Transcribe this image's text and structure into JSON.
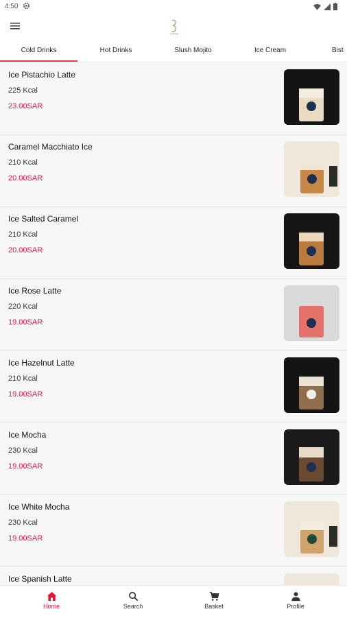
{
  "status": {
    "time": "4:50"
  },
  "tabs": [
    {
      "label": "Cold Drinks",
      "active": true
    },
    {
      "label": "Hot Drinks",
      "active": false
    },
    {
      "label": "Slush Mojito",
      "active": false
    },
    {
      "label": "Ice Cream",
      "active": false
    },
    {
      "label": "Bist",
      "active": false
    }
  ],
  "items": [
    {
      "name": "Ice Pistachio Latte",
      "kcal": "225 Kcal",
      "price": "23.00SAR",
      "image": "dark-bg"
    },
    {
      "name": "Caramel Macchiato Ice",
      "kcal": "210 Kcal",
      "price": "20.00SAR",
      "image": "light-bg"
    },
    {
      "name": "Ice Salted Caramel",
      "kcal": "210 Kcal",
      "price": "20.00SAR",
      "image": "dark-bg"
    },
    {
      "name": "Ice Rose Latte",
      "kcal": "220 Kcal",
      "price": "19.00SAR",
      "image": "grey-bg"
    },
    {
      "name": "Ice Hazelnut Latte",
      "kcal": "210 Kcal",
      "price": "19.00SAR",
      "image": "dark-bg"
    },
    {
      "name": "Ice Mocha",
      "kcal": "230 Kcal",
      "price": "19.00SAR",
      "image": "dark-bg"
    },
    {
      "name": "Ice White Mocha",
      "kcal": "230 Kcal",
      "price": "19.00SAR",
      "image": "light-bg"
    },
    {
      "name": "Ice Spanish Latte",
      "kcal": "",
      "price": "",
      "image": "light-bg"
    }
  ],
  "bottom_nav": [
    {
      "label": "Home",
      "icon": "home-icon",
      "active": true
    },
    {
      "label": "Search",
      "icon": "search-icon",
      "active": false
    },
    {
      "label": "Basket",
      "icon": "cart-icon",
      "active": false
    },
    {
      "label": "Profile",
      "icon": "person-icon",
      "active": false
    }
  ],
  "colors": {
    "accent": "#e8143c",
    "tab_indicator": "#e53950"
  }
}
